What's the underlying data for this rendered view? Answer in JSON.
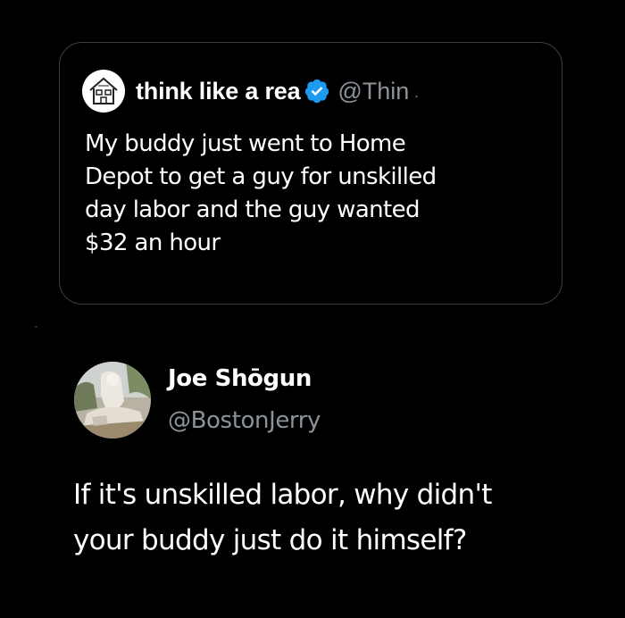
{
  "quoted_tweet": {
    "author_name": "think like a rea",
    "author_handle": "@Thin",
    "verified": true,
    "avatar_icon": "house-sketch-icon",
    "text_lines": [
      "My buddy just went to Home",
      "Depot to get a guy for unskilled",
      "day labor and the guy wanted",
      "$32 an hour"
    ]
  },
  "reply_tweet": {
    "author_name": "Joe Shōgun",
    "author_handle": "@BostonJerry",
    "avatar_icon": "profile-photo",
    "text_lines": [
      "If it's unskilled labor, why didn't",
      "your buddy just do it himself?"
    ]
  },
  "colors": {
    "background": "#000000",
    "text_primary": "#ffffff",
    "text_secondary": "#8b9299",
    "card_border": "#3a3f44",
    "verified_blue": "#1d9bf0"
  }
}
